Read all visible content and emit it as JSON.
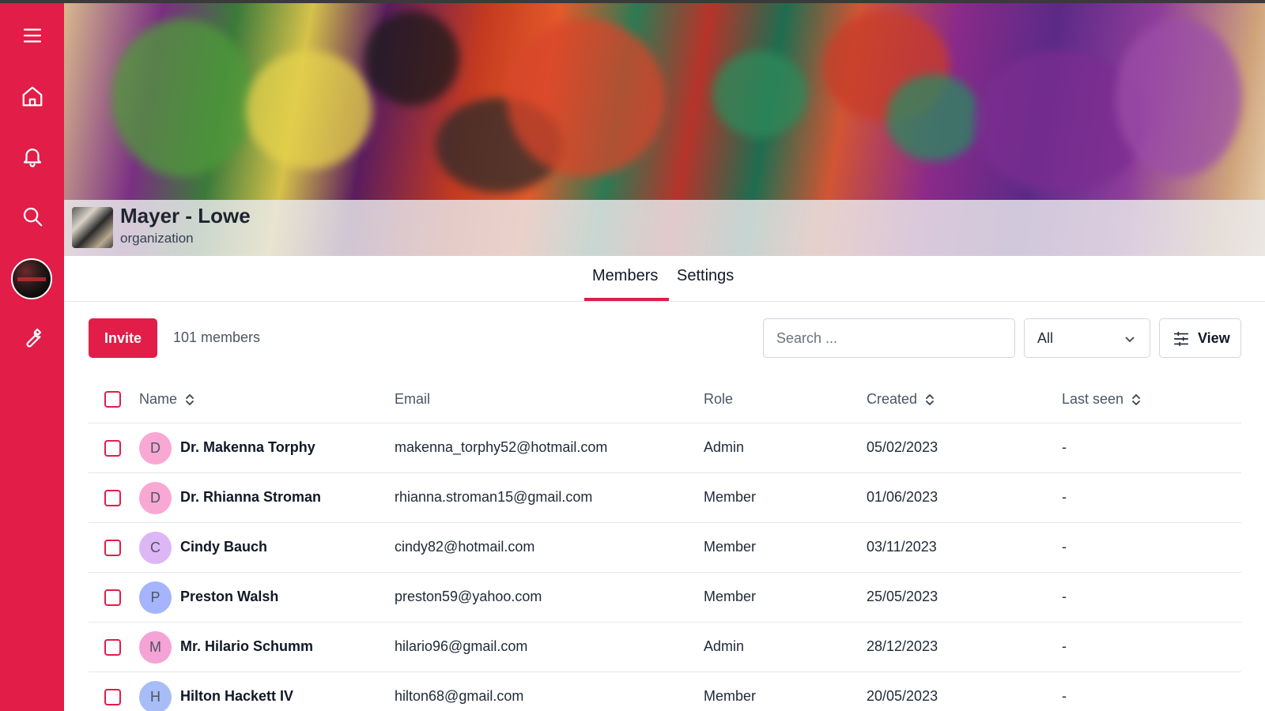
{
  "sidebar": {
    "items": [
      {
        "icon": "menu-icon"
      },
      {
        "icon": "home-icon"
      },
      {
        "icon": "bell-icon"
      },
      {
        "icon": "search-icon"
      },
      {
        "icon": "user-avatar"
      },
      {
        "icon": "wrench-icon"
      }
    ]
  },
  "organization": {
    "name": "Mayer - Lowe",
    "type": "organization"
  },
  "tabs": [
    {
      "label": "Members",
      "active": true
    },
    {
      "label": "Settings",
      "active": false
    }
  ],
  "toolbar": {
    "invite_label": "Invite",
    "member_count": "101 members",
    "search_placeholder": "Search ...",
    "filter_value": "All",
    "view_label": "View"
  },
  "table": {
    "headers": {
      "name": "Name",
      "email": "Email",
      "role": "Role",
      "created": "Created",
      "last_seen": "Last seen"
    },
    "rows": [
      {
        "initial": "D",
        "avatar_color": "#f9a8d4",
        "name": "Dr. Makenna Torphy",
        "email": "makenna_torphy52@hotmail.com",
        "role": "Admin",
        "created": "05/02/2023",
        "last_seen": "-"
      },
      {
        "initial": "D",
        "avatar_color": "#f9a8d4",
        "name": "Dr. Rhianna Stroman",
        "email": "rhianna.stroman15@gmail.com",
        "role": "Member",
        "created": "01/06/2023",
        "last_seen": "-"
      },
      {
        "initial": "C",
        "avatar_color": "#ddb6f5",
        "name": "Cindy Bauch",
        "email": "cindy82@hotmail.com",
        "role": "Member",
        "created": "03/11/2023",
        "last_seen": "-"
      },
      {
        "initial": "P",
        "avatar_color": "#a5b4fc",
        "name": "Preston Walsh",
        "email": "preston59@yahoo.com",
        "role": "Member",
        "created": "25/05/2023",
        "last_seen": "-"
      },
      {
        "initial": "M",
        "avatar_color": "#f5a3d6",
        "name": "Mr. Hilario Schumm",
        "email": "hilario96@gmail.com",
        "role": "Admin",
        "created": "28/12/2023",
        "last_seen": "-"
      },
      {
        "initial": "H",
        "avatar_color": "#a8bdf7",
        "name": "Hilton Hackett IV",
        "email": "hilton68@gmail.com",
        "role": "Member",
        "created": "20/05/2023",
        "last_seen": "-"
      }
    ]
  },
  "colors": {
    "accent": "#e11d48"
  }
}
